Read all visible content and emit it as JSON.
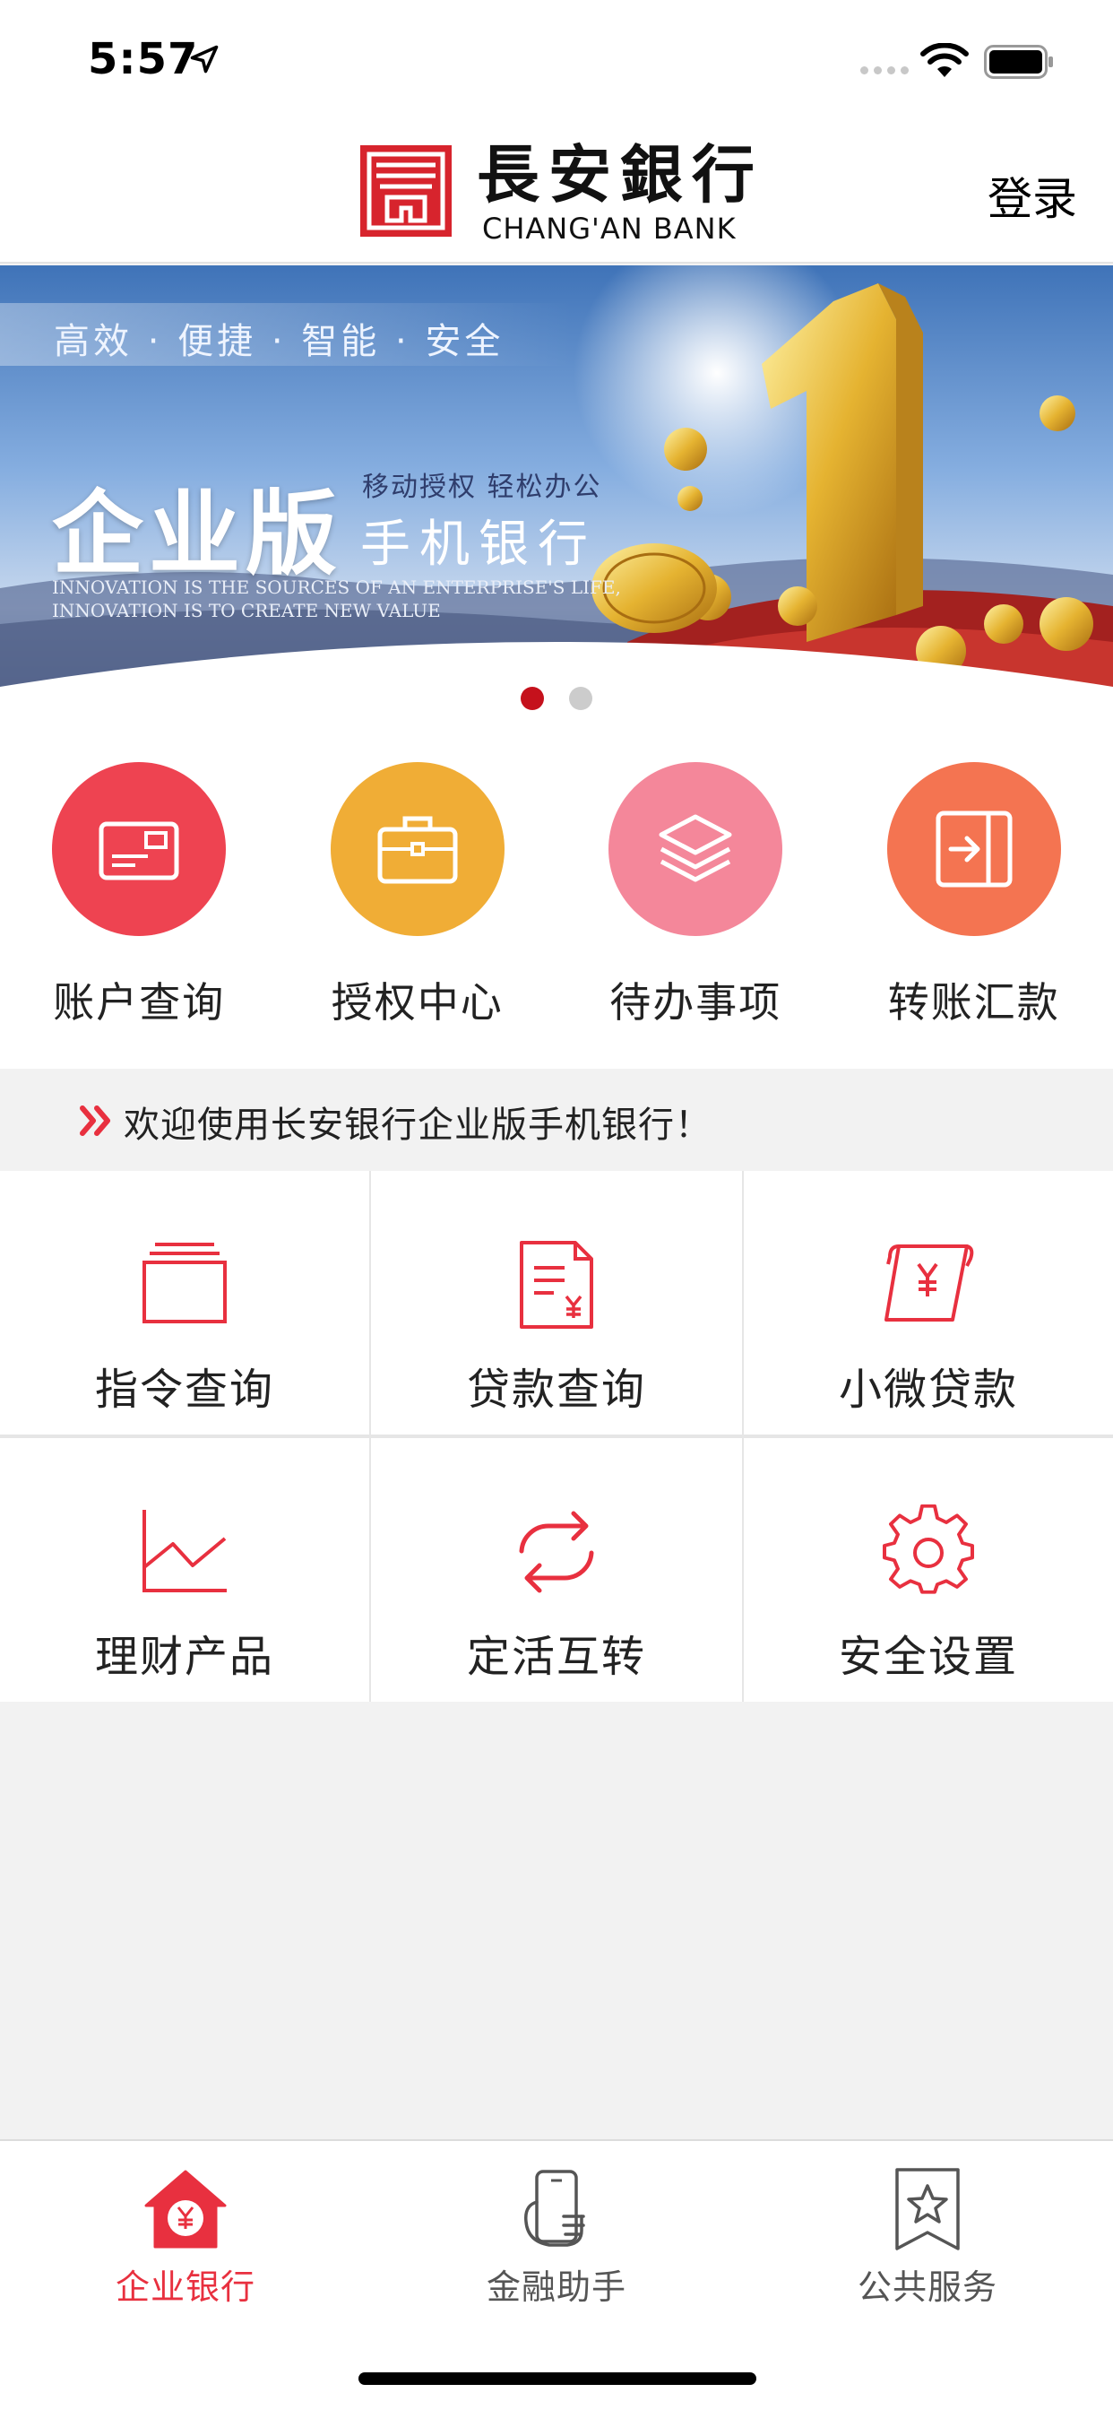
{
  "status_bar": {
    "time": "5:57",
    "icons": [
      "location-arrow-icon",
      "signal-dots-icon",
      "wifi-icon",
      "battery-icon"
    ]
  },
  "header": {
    "logo_cn": "長安銀行",
    "logo_en": "CHANG'AN BANK",
    "login_label": "登录"
  },
  "banner": {
    "slogan": "高效 · 便捷 · 智能 · 安全",
    "edition": "企业版",
    "sub_top": "移动授权 轻松办公",
    "sub_main": "手机银行",
    "en_line1": "INNOVATION IS THE SOURCES OF AN ENTERPRISE'S LIFE,",
    "en_line2": "INNOVATION IS TO CREATE NEW VALUE",
    "active_page": 1,
    "page_count": 2
  },
  "quick_actions": [
    {
      "label": "账户查询",
      "icon": "card-icon",
      "color": "#ee4351"
    },
    {
      "label": "授权中心",
      "icon": "briefcase-icon",
      "color": "#f0ad36"
    },
    {
      "label": "待办事项",
      "icon": "layers-icon",
      "color": "#f4879a"
    },
    {
      "label": "转账汇款",
      "icon": "transfer-icon",
      "color": "#f47451"
    }
  ],
  "notice": {
    "text": "欢迎使用长安银行企业版手机银行！"
  },
  "services": [
    {
      "label": "指令查询",
      "icon": "folder-icon"
    },
    {
      "label": "贷款查询",
      "icon": "loan-document-icon"
    },
    {
      "label": "小微贷款",
      "icon": "yuan-scroll-icon"
    },
    {
      "label": "理财产品",
      "icon": "line-chart-icon"
    },
    {
      "label": "定活互转",
      "icon": "refresh-arrows-icon"
    },
    {
      "label": "安全设置",
      "icon": "gear-icon"
    }
  ],
  "tab_bar": {
    "items": [
      {
        "label": "企业银行",
        "icon": "house-yuan-icon",
        "active": true
      },
      {
        "label": "金融助手",
        "icon": "phone-hand-icon",
        "active": false
      },
      {
        "label": "公共服务",
        "icon": "star-bookmark-icon",
        "active": false
      }
    ]
  },
  "colors": {
    "brand_red": "#e8303f",
    "text_dark": "#222222",
    "inactive_gray": "#555555",
    "dot_active": "#c5111c",
    "dot_inactive": "#cccccc"
  }
}
